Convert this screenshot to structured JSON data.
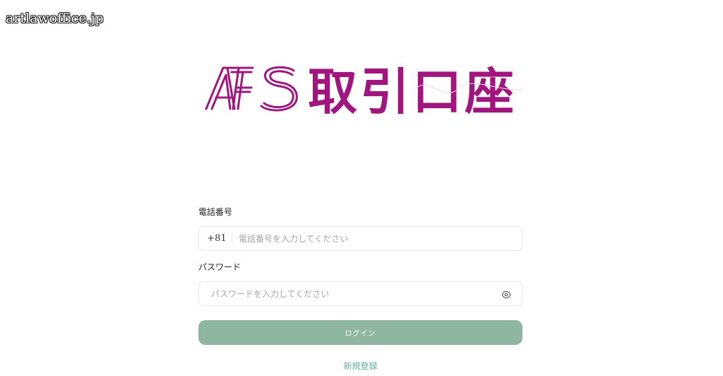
{
  "watermark": "artlawoffice.jp",
  "logo": {
    "text": "AFS 取引口座",
    "color": "#a0157e"
  },
  "phone": {
    "label": "電話番号",
    "prefix": "+81",
    "placeholder": "電話番号を入力してください",
    "value": ""
  },
  "password": {
    "label": "パスワード",
    "placeholder": "パスワードを入力してください",
    "value": "",
    "toggle_icon": "eye-icon"
  },
  "login": {
    "label": "ログイン",
    "color": "#8fb6a1"
  },
  "register": {
    "label": "新規登録",
    "color": "#62b0a6"
  }
}
